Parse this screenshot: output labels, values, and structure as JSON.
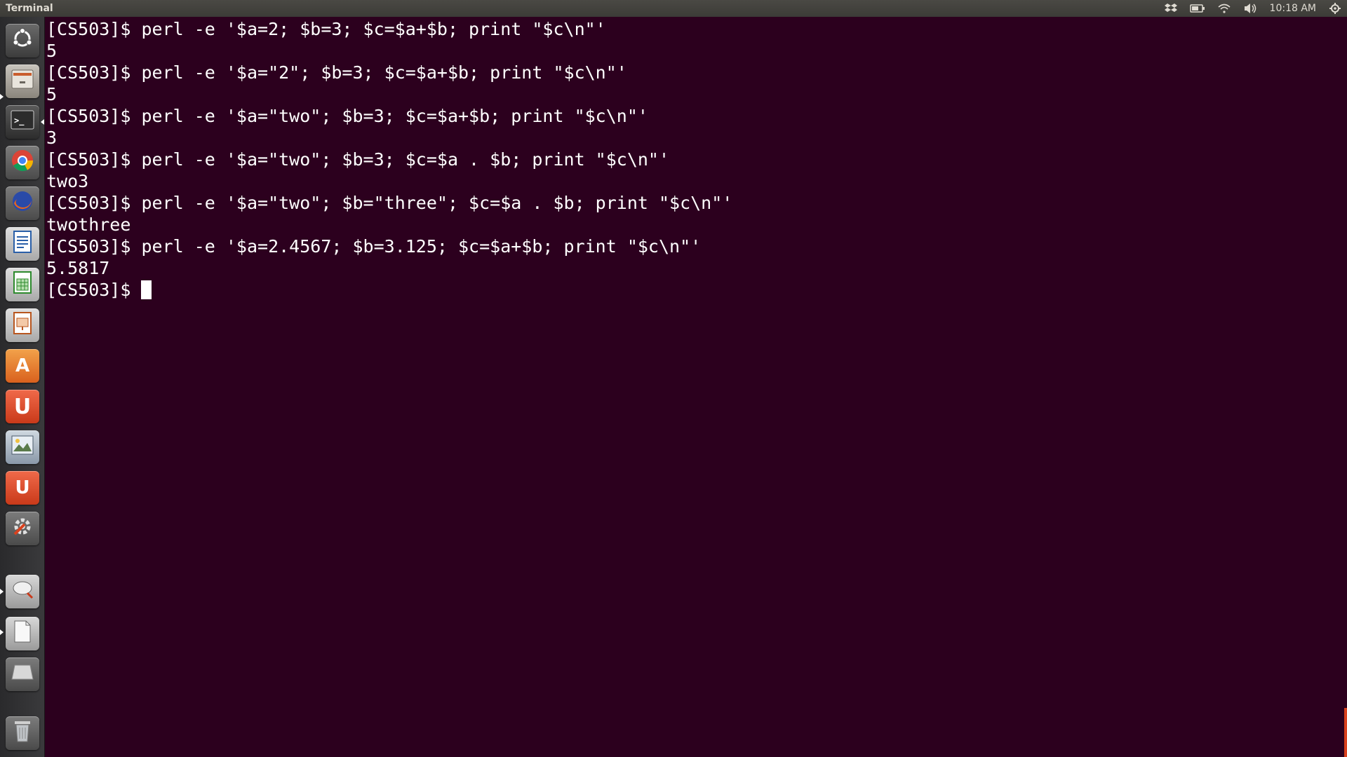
{
  "top_panel": {
    "title": "Terminal",
    "clock": "10:18 AM",
    "icons": [
      "dropbox-icon",
      "battery-icon",
      "wifi-icon",
      "volume-icon",
      "power-gear-icon"
    ]
  },
  "launcher": {
    "items": [
      {
        "name": "dash-home",
        "icon": "ubuntu-logo-icon"
      },
      {
        "name": "files",
        "icon": "file-cabinet-icon"
      },
      {
        "name": "terminal",
        "icon": "terminal-icon",
        "glyph": ">_"
      },
      {
        "name": "chrome",
        "icon": "chrome-icon"
      },
      {
        "name": "firefox",
        "icon": "firefox-icon"
      },
      {
        "name": "libreoffice-writer",
        "icon": "writer-document-icon"
      },
      {
        "name": "libreoffice-calc",
        "icon": "calc-spreadsheet-icon"
      },
      {
        "name": "libreoffice-impress",
        "icon": "impress-presentation-icon"
      },
      {
        "name": "software-center",
        "icon": "software-center-icon",
        "glyph": "A"
      },
      {
        "name": "ubuntu-one",
        "icon": "ubuntu-one-icon",
        "glyph": "U"
      },
      {
        "name": "image-viewer",
        "icon": "image-viewer-icon"
      },
      {
        "name": "ubuntu-one-music",
        "icon": "ubuntu-one-music-icon",
        "glyph": "U"
      },
      {
        "name": "system-settings",
        "icon": "system-settings-icon"
      },
      {
        "name": "disk-utility",
        "icon": "disk-icon"
      },
      {
        "name": "text-editor",
        "icon": "blank-document-icon"
      },
      {
        "name": "drive",
        "icon": "drive-icon"
      },
      {
        "name": "trash",
        "icon": "trash-icon"
      }
    ]
  },
  "terminal": {
    "lines": [
      "[CS503]$ perl -e '$a=2; $b=3; $c=$a+$b; print \"$c\\n\"'",
      "5",
      "[CS503]$ perl -e '$a=\"2\"; $b=3; $c=$a+$b; print \"$c\\n\"'",
      "5",
      "[CS503]$ perl -e '$a=\"two\"; $b=3; $c=$a+$b; print \"$c\\n\"'",
      "3",
      "[CS503]$ perl -e '$a=\"two\"; $b=3; $c=$a . $b; print \"$c\\n\"'",
      "two3",
      "[CS503]$ perl -e '$a=\"two\"; $b=\"three\"; $c=$a . $b; print \"$c\\n\"'",
      "twothree",
      "[CS503]$ perl -e '$a=2.4567; $b=3.125; $c=$a+$b; print \"$c\\n\"'",
      "5.5817"
    ],
    "prompt": "[CS503]$ "
  },
  "colors": {
    "terminal_bg": "#2c001e",
    "text": "#ffffff"
  }
}
